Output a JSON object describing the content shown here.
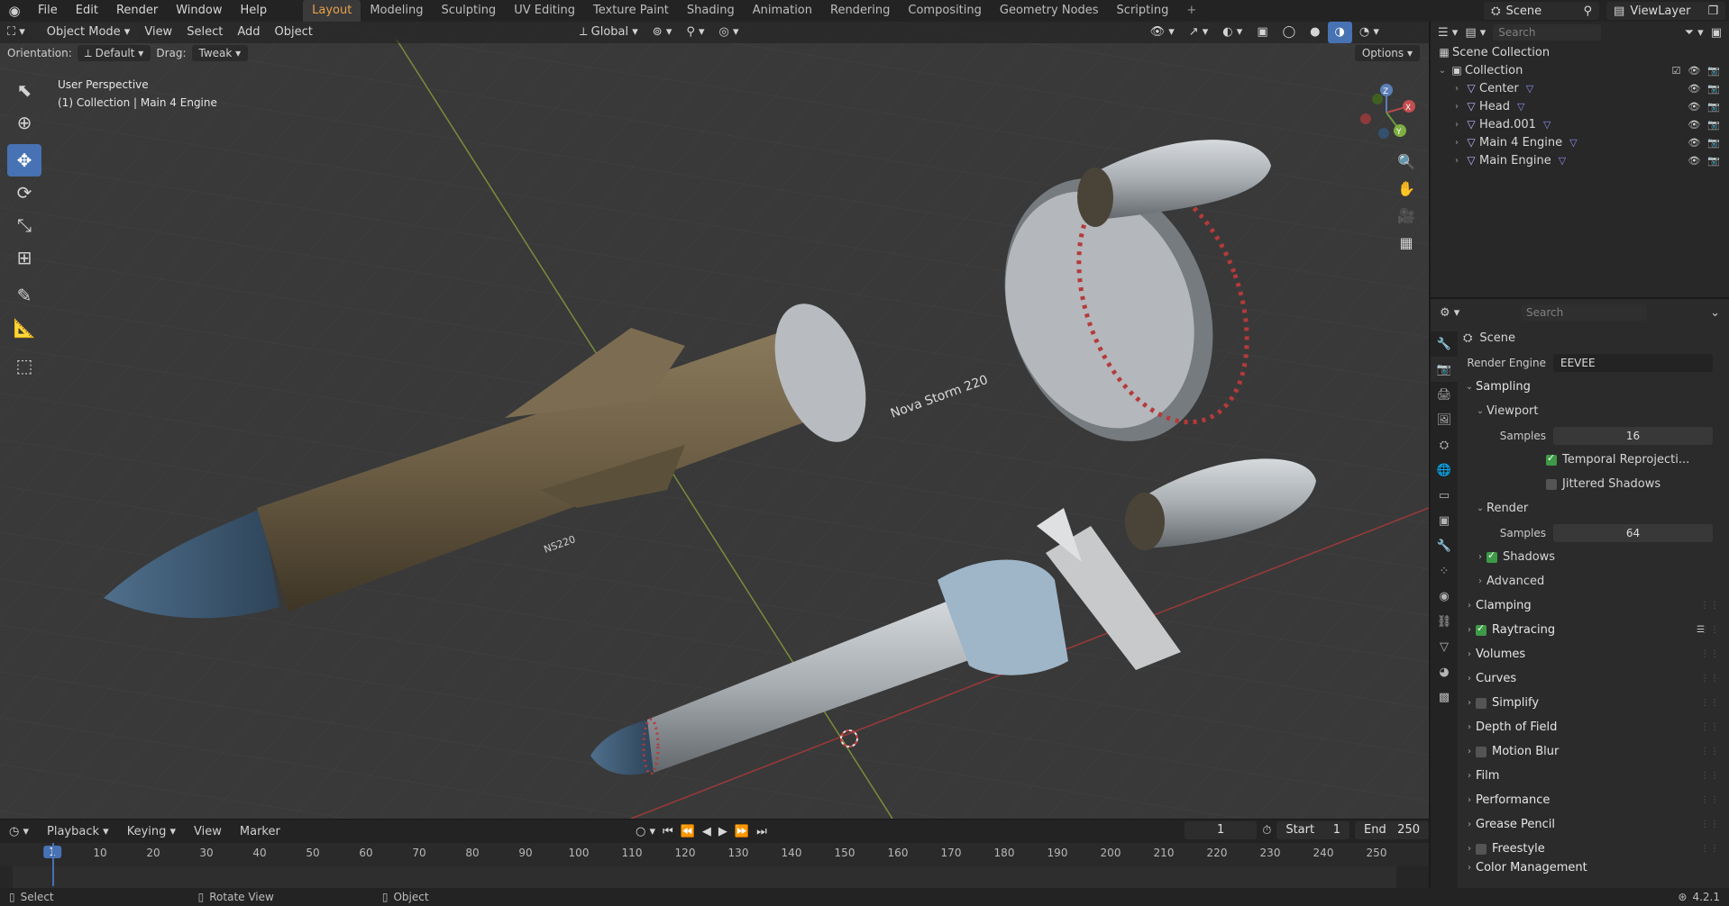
{
  "topbar": {
    "menu": [
      "File",
      "Edit",
      "Render",
      "Window",
      "Help"
    ],
    "workspaces": [
      "Layout",
      "Modeling",
      "Sculpting",
      "UV Editing",
      "Texture Paint",
      "Shading",
      "Animation",
      "Rendering",
      "Compositing",
      "Geometry Nodes",
      "Scripting"
    ],
    "active_workspace": "Layout",
    "scene": "Scene",
    "view_layer": "ViewLayer"
  },
  "viewport": {
    "mode": "Object Mode",
    "menus": [
      "View",
      "Select",
      "Add",
      "Object"
    ],
    "transform_orientation": "Global",
    "orientation_label": "Orientation:",
    "orientation_value": "Default",
    "drag_label": "Drag:",
    "drag_value": "Tweak",
    "options_label": "Options",
    "info_line1": "User Perspective",
    "info_line2": "(1) Collection | Main 4 Engine",
    "model_label_large": "Nova Storm 220",
    "model_label_small": "NS220"
  },
  "outliner": {
    "search_placeholder": "Search",
    "scene_collection": "Scene Collection",
    "collection": "Collection",
    "objects": [
      "Center",
      "Head",
      "Head.001",
      "Main 4 Engine",
      "Main Engine"
    ]
  },
  "properties": {
    "search_placeholder": "Search",
    "context": "Scene",
    "render_engine_label": "Render Engine",
    "render_engine": "EEVEE",
    "sampling": "Sampling",
    "viewport": "Viewport",
    "samples_label": "Samples",
    "viewport_samples": "16",
    "temporal_reprojection": "Temporal Reprojecti...",
    "jittered_shadows": "Jittered Shadows",
    "render": "Render",
    "render_samples": "64",
    "shadows": "Shadows",
    "advanced": "Advanced",
    "panels": [
      "Clamping",
      "Raytracing",
      "Volumes",
      "Curves",
      "Simplify",
      "Depth of Field",
      "Motion Blur",
      "Film",
      "Performance",
      "Grease Pencil",
      "Freestyle",
      "Color Management"
    ]
  },
  "timeline": {
    "menus": [
      "Playback",
      "Keying",
      "View",
      "Marker"
    ],
    "current_frame": "1",
    "start_label": "Start",
    "start": "1",
    "end_label": "End",
    "end": "250",
    "ruler": [
      "10",
      "20",
      "30",
      "40",
      "50",
      "60",
      "70",
      "80",
      "90",
      "100",
      "110",
      "120",
      "130",
      "140",
      "150",
      "160",
      "170",
      "180",
      "190",
      "200",
      "210",
      "220",
      "230",
      "240",
      "250"
    ]
  },
  "statusbar": {
    "select": "Select",
    "rotate_view": "Rotate View",
    "object": "Object",
    "version": "4.2.1"
  }
}
